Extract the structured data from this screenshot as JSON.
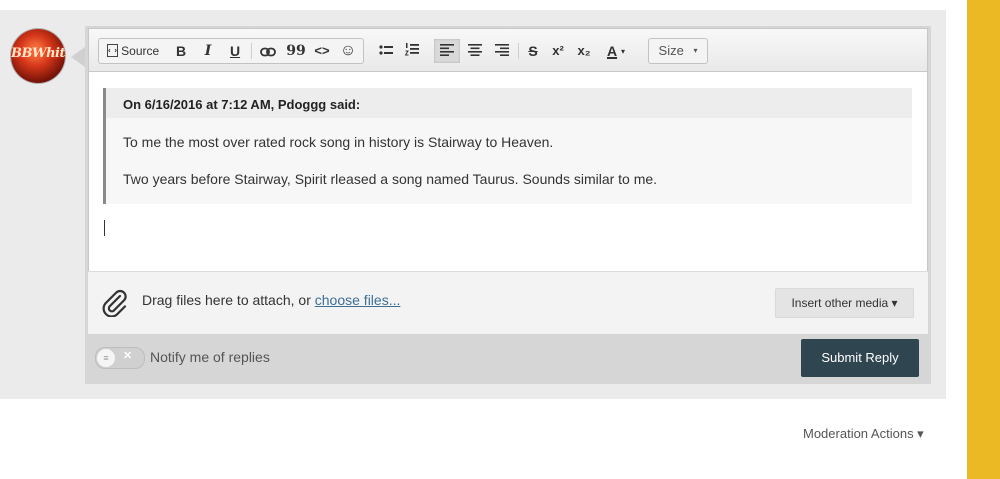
{
  "avatar": {
    "text": "BBWhite"
  },
  "toolbar": {
    "source_label": "Source",
    "bold": "B",
    "italic": "I",
    "underline": "U",
    "quote_glyph": "99",
    "code_glyph": "<>",
    "emoji_glyph": "☺",
    "strike": "S",
    "superscript": "x²",
    "subscript": "x₂",
    "font_color": "A",
    "size_label": "Size"
  },
  "editor": {
    "quote_citation": "On 6/16/2016 at 7:12 AM, Pdoggg said:",
    "quote_lines": [
      "To me the most over rated rock song in history is Stairway to Heaven.",
      "Two years before Stairway, Spirit rleased a song named Taurus.  Sounds similar to me."
    ]
  },
  "attach": {
    "drag_text": "Drag files here to attach, or ",
    "choose_link": "choose files...",
    "insert_media": "Insert other media ▾"
  },
  "notify": {
    "label": "Notify me of replies"
  },
  "submit": {
    "label": "Submit Reply"
  },
  "moderation": {
    "label": "Moderation Actions ▾"
  },
  "colors": {
    "accent_stripe": "#ebb924",
    "submit_bg": "#2f4550",
    "link": "#3d6e98"
  }
}
